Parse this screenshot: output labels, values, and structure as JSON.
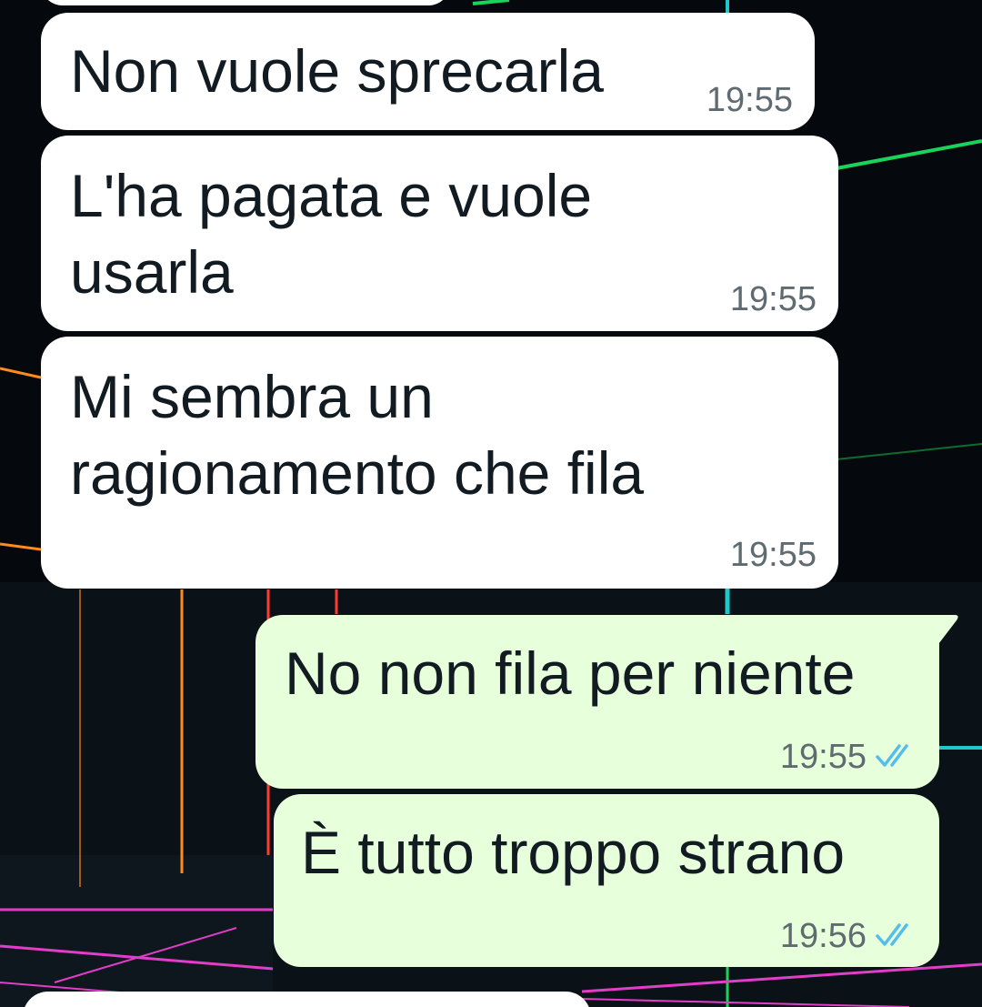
{
  "chat": {
    "messages": [
      {
        "direction": "incoming",
        "text": "Non vuole sprecarla",
        "time": "19:55"
      },
      {
        "direction": "incoming",
        "text": "L'ha pagata e vuole\nusarla",
        "time": "19:55"
      },
      {
        "direction": "incoming",
        "text": "Mi sembra un\nragionamento che fila",
        "time": "19:55"
      },
      {
        "direction": "outgoing",
        "text": "No non fila per niente",
        "time": "19:55",
        "status": "read"
      },
      {
        "direction": "outgoing",
        "text": "È tutto troppo strano",
        "time": "19:56",
        "status": "read"
      }
    ]
  },
  "theme": {
    "incoming_bubble": "#ffffff",
    "outgoing_bubble": "#e7ffdb",
    "read_tick_color": "#53bdeb",
    "wallpaper_base": "#05090d",
    "neon_colors": [
      "#19d35a",
      "#1fc9c9",
      "#ff8a1e",
      "#e23dc9",
      "#ff3b2f"
    ]
  },
  "icons": {
    "read_status": "double-check-icon"
  }
}
